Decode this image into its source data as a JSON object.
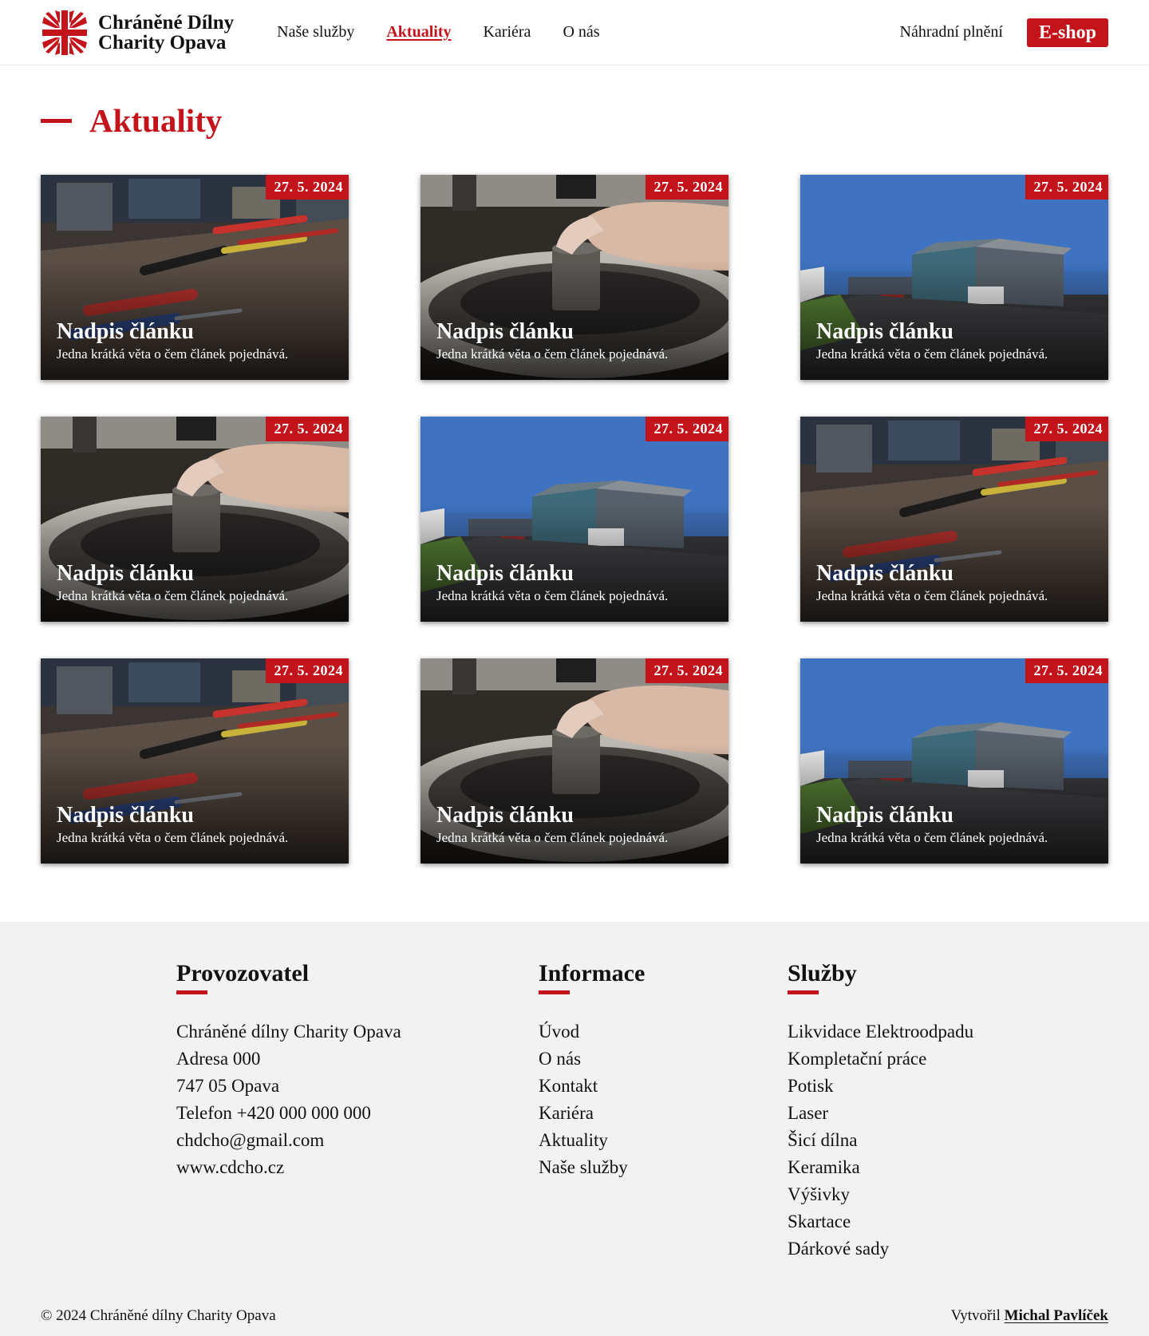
{
  "header": {
    "logo_line1": "Chráněné Dílny",
    "logo_line2": "Charity Opava",
    "nav": [
      {
        "label": "Naše služby"
      },
      {
        "label": "Aktuality"
      },
      {
        "label": "Kariéra"
      },
      {
        "label": "O nás"
      }
    ],
    "replacement_link": "Náhradní plnění",
    "eshop_label": "E-shop",
    "accent_color": "#c4141b"
  },
  "main": {
    "title": "Aktuality",
    "articles": [
      {
        "date": "27. 5. 2024",
        "title": "Nadpis článku",
        "desc": "Jedna krátká věta o čem článek pojednává.",
        "image": "tools-workbench"
      },
      {
        "date": "27. 5. 2024",
        "title": "Nadpis článku",
        "desc": "Jedna krátká věta o čem článek pojednává.",
        "image": "pottery-wheel"
      },
      {
        "date": "27. 5. 2024",
        "title": "Nadpis článku",
        "desc": "Jedna krátká věta o čem článek pojednává.",
        "image": "building-exterior"
      },
      {
        "date": "27. 5. 2024",
        "title": "Nadpis článku",
        "desc": "Jedna krátká věta o čem článek pojednává.",
        "image": "pottery-wheel"
      },
      {
        "date": "27. 5. 2024",
        "title": "Nadpis článku",
        "desc": "Jedna krátká věta o čem článek pojednává.",
        "image": "building-exterior"
      },
      {
        "date": "27. 5. 2024",
        "title": "Nadpis článku",
        "desc": "Jedna krátká věta o čem článek pojednává.",
        "image": "tools-workbench"
      },
      {
        "date": "27. 5. 2024",
        "title": "Nadpis článku",
        "desc": "Jedna krátká věta o čem článek pojednává.",
        "image": "tools-workbench"
      },
      {
        "date": "27. 5. 2024",
        "title": "Nadpis článku",
        "desc": "Jedna krátká věta o čem článek pojednává.",
        "image": "pottery-wheel"
      },
      {
        "date": "27. 5. 2024",
        "title": "Nadpis článku",
        "desc": "Jedna krátká věta o čem článek pojednává.",
        "image": "building-exterior"
      }
    ]
  },
  "footer": {
    "operator": {
      "heading": "Provozovatel",
      "lines": [
        "Chráněné dílny Charity Opava",
        "Adresa 000",
        "747 05 Opava",
        "Telefon +420 000 000 000",
        "chdcho@gmail.com",
        "www.cdcho.cz"
      ]
    },
    "info": {
      "heading": "Informace",
      "links": [
        "Úvod",
        "O nás",
        "Kontakt",
        "Kariéra",
        "Aktuality",
        "Naše služby"
      ]
    },
    "services": {
      "heading": "Služby",
      "links": [
        "Likvidace Elektroodpadu",
        "Kompletační práce",
        "Potisk",
        "Laser",
        "Šicí dílna",
        "Keramika",
        "Výšivky",
        "Skartace",
        "Dárkové sady"
      ]
    },
    "copyright": "© 2024 Chráněné dílny Charity Opava",
    "credit_prefix": "Vytvořil",
    "credit_author": "Michal Pavlíček"
  }
}
